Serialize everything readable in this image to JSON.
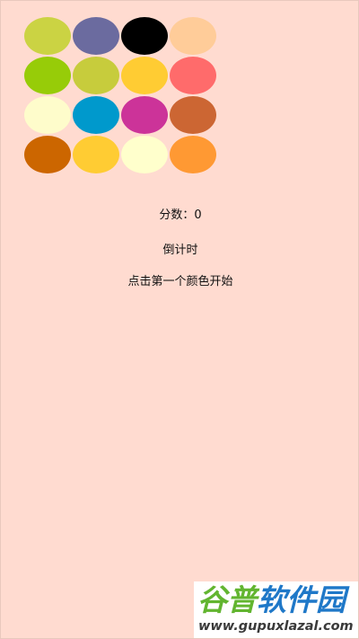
{
  "app": {
    "background": "#ffdbd0"
  },
  "board": {
    "rows": [
      [
        "#cbd343",
        "#6b6b9f",
        "#000000",
        "#ffcc99"
      ],
      [
        "#97cc08",
        "#c7cc3c",
        "#ffcc33",
        "#ff6b6b"
      ],
      [
        "#fefccb",
        "#0099cc",
        "#cc3399",
        "#cc6633"
      ],
      [
        "#cc6600",
        "#ffcc33",
        "#ffffcc",
        "#ff9933"
      ]
    ]
  },
  "status": {
    "score_text": "分数：0",
    "timer_text": "倒计时",
    "hint_text": "点击第一个颜色开始"
  },
  "watermark": {
    "brand_part1": "谷普",
    "brand_part2": "软件园",
    "url": "www.gupuxlazal.com",
    "color_green": "#62b530",
    "color_blue": "#1f78c8"
  }
}
